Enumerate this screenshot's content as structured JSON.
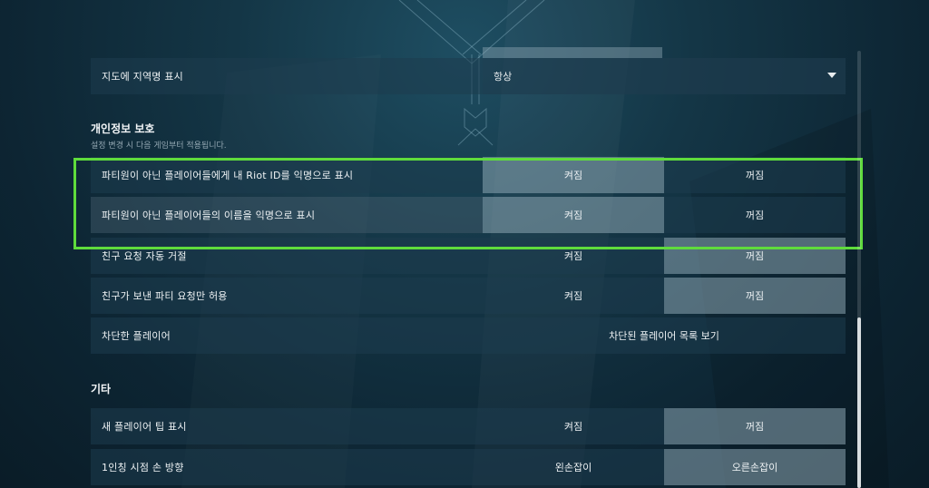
{
  "map_region_row": {
    "label": "지도에 지역명 표시",
    "value": "항상"
  },
  "privacy": {
    "title": "개인정보 보호",
    "subtitle": "설정 변경 시 다음 게임부터 적용됩니다.",
    "rows": [
      {
        "label": "파티원이 아닌 플레이어들에게 내 Riot ID를 익명으로 표시",
        "on": "켜짐",
        "off": "꺼짐"
      },
      {
        "label": "파티원이 아닌 플레이어들의 이름을 익명으로 표시",
        "on": "켜짐",
        "off": "꺼짐"
      },
      {
        "label": "친구 요청 자동 거절",
        "on": "켜짐",
        "off": "꺼짐"
      },
      {
        "label": "친구가 보낸 파티 요청만 허용",
        "on": "켜짐",
        "off": "꺼짐"
      }
    ],
    "blocked": {
      "label": "차단한 플레이어",
      "action": "차단된 플레이어 목록 보기"
    }
  },
  "misc": {
    "title": "기타",
    "rows": [
      {
        "label": "새 플레이어 팁 표시",
        "on": "켜짐",
        "off": "꺼짐"
      },
      {
        "label": "1인칭 시점 손 방향",
        "on": "왼손잡이",
        "off": "오른손잡이"
      }
    ]
  },
  "colors": {
    "highlight": "#5fdc3c"
  }
}
